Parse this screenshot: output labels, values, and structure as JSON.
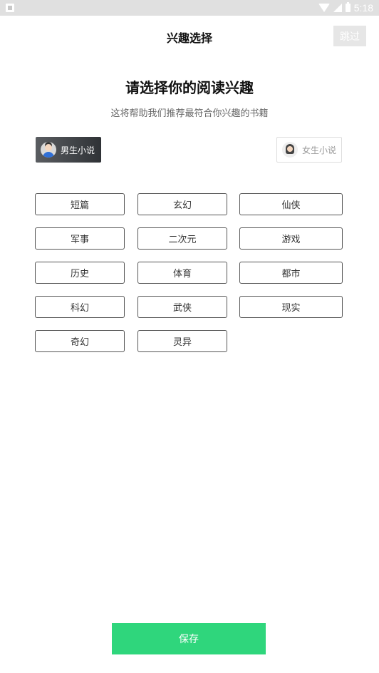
{
  "status_bar": {
    "time": "5:18",
    "icons": [
      "notification-icon",
      "wifi-icon",
      "signal-icon",
      "battery-icon"
    ]
  },
  "header": {
    "title": "兴趣选择",
    "skip_label": "跳过"
  },
  "intro": {
    "title": "请选择你的阅读兴趣",
    "subtitle": "这将帮助我们推荐最符合你兴趣的书籍"
  },
  "gender": {
    "male_label": "男生小说",
    "female_label": "女生小说",
    "selected": "male"
  },
  "tags": [
    "短篇",
    "玄幻",
    "仙侠",
    "军事",
    "二次元",
    "游戏",
    "历史",
    "体育",
    "都市",
    "科幻",
    "武侠",
    "现实",
    "奇幻",
    "灵异"
  ],
  "save_label": "保存",
  "colors": {
    "accent": "#2fd67c",
    "status_bar": "#e0e0e0",
    "selected_gender": "#3e4145",
    "tag_border": "#555555"
  }
}
